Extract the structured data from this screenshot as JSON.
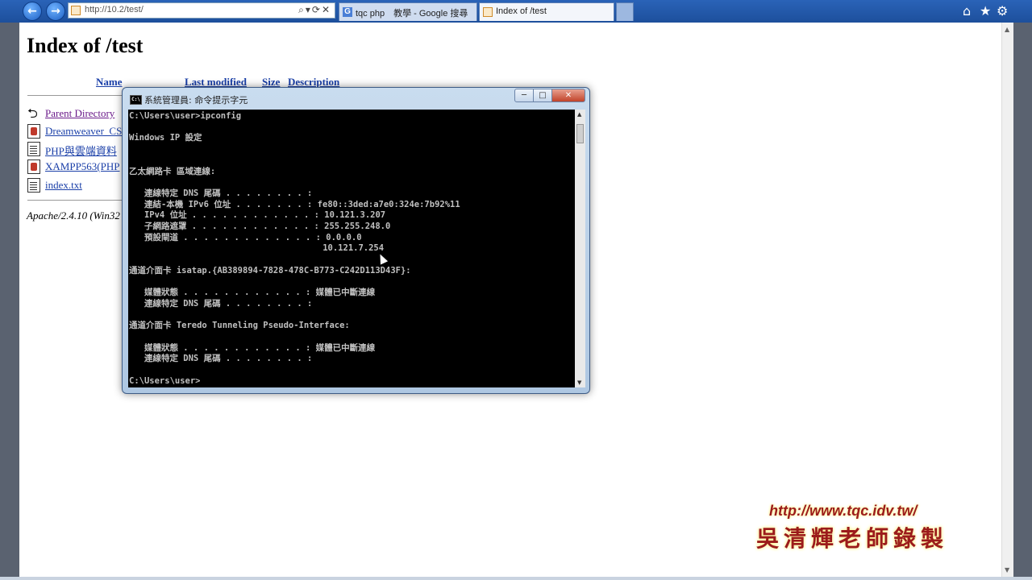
{
  "browser": {
    "url": "http://10.2/test/",
    "tabs": [
      {
        "label": "tqc php　教學 - Google 搜尋",
        "favicon": "G"
      },
      {
        "label": "Index of /test"
      }
    ],
    "icons": [
      "back-icon",
      "forward-icon",
      "home-icon",
      "favorites-icon",
      "gear-icon"
    ]
  },
  "page": {
    "title": "Index of /test",
    "columns": {
      "name": "Name",
      "modified": "Last modified",
      "size": "Size",
      "description": "Description"
    },
    "rows": [
      {
        "label": "Parent Directory",
        "icon": "back-icon"
      },
      {
        "label": "Dreamweaver_CS",
        "icon": "film-icon"
      },
      {
        "label": "PHP與雲端資料",
        "icon": "document-icon"
      },
      {
        "label": "XAMPP563(PHP",
        "icon": "film-icon"
      },
      {
        "label": "index.txt",
        "icon": "document-icon"
      }
    ],
    "footer": "Apache/2.4.10 (Win32"
  },
  "cmd": {
    "title": "系統管理員: 命令提示字元",
    "buttons": {
      "minimize": "─",
      "maximize": "□",
      "close": "✕"
    },
    "lines": [
      "C:\\Users\\user>ipconfig",
      "",
      "Windows IP 設定",
      "",
      "",
      "乙太網路卡 區域連線:",
      "",
      "   連線特定 DNS 尾碼 . . . . . . . . :",
      "   連結-本機 IPv6 位址 . . . . . . . : fe80::3ded:a7e0:324e:7b92%11",
      "   IPv4 位址 . . . . . . . . . . . . : 10.121.3.207",
      "   子網路遮罩 . . . . . . . . . . . . : 255.255.248.0",
      "   預設閘道 . . . . . . . . . . . . . : 0.0.0.0",
      "                                      10.121.7.254",
      "",
      "通道介面卡 isatap.{AB389894-7828-478C-B773-C242D113D43F}:",
      "",
      "   媒體狀態 . . . . . . . . . . . . : 媒體已中斷連線",
      "   連線特定 DNS 尾碼 . . . . . . . . :",
      "",
      "通道介面卡 Teredo Tunneling Pseudo-Interface:",
      "",
      "   媒體狀態 . . . . . . . . . . . . : 媒體已中斷連線",
      "   連線特定 DNS 尾碼 . . . . . . . . :",
      "",
      "C:\\Users\\user>"
    ]
  },
  "watermark": {
    "url": "http://www.tqc.idv.tw/",
    "author": "吳清輝老師錄製"
  }
}
